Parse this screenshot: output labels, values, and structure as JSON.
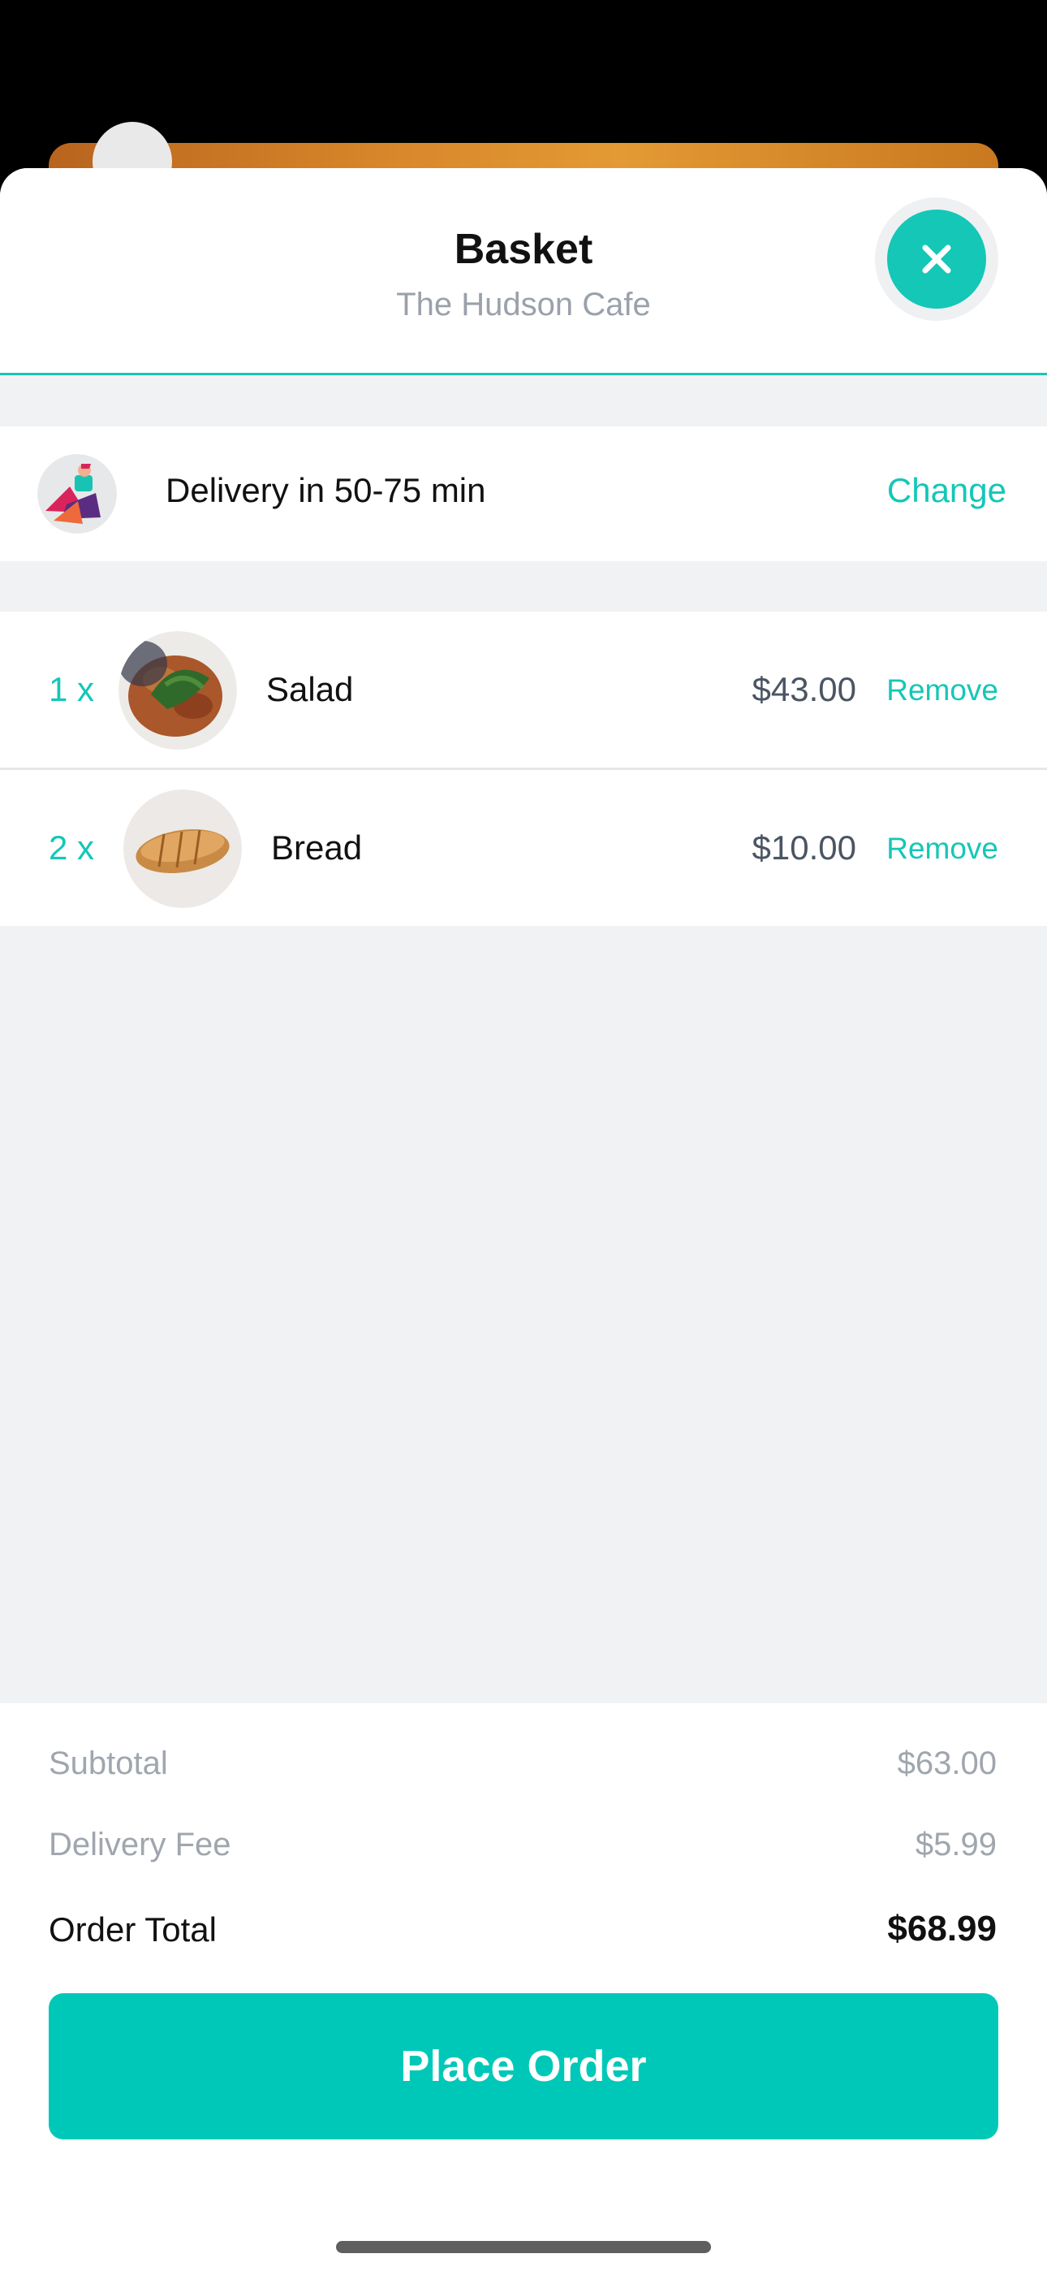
{
  "header": {
    "title": "Basket",
    "subtitle": "The Hudson Cafe",
    "close_icon": "close-icon"
  },
  "delivery": {
    "text": "Delivery in 50-75 min",
    "change_label": "Change",
    "icon": "delivery-scooter-icon"
  },
  "items": [
    {
      "qty": "1 x",
      "name": "Salad",
      "price": "$43.00",
      "remove_label": "Remove"
    },
    {
      "qty": "2 x",
      "name": "Bread",
      "price": "$10.00",
      "remove_label": "Remove"
    }
  ],
  "summary": {
    "subtotal_label": "Subtotal",
    "subtotal_value": "$63.00",
    "delivery_fee_label": "Delivery Fee",
    "delivery_fee_value": "$5.99",
    "order_total_label": "Order Total",
    "order_total_value": "$68.99"
  },
  "cta": {
    "label": "Place Order"
  },
  "colors": {
    "accent": "#14c7b7",
    "button": "#00c8b8",
    "background": "#f1f2f4"
  }
}
